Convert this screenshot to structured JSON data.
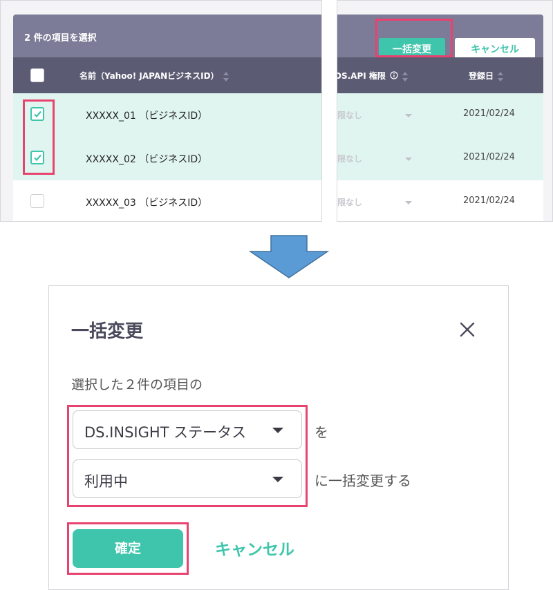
{
  "table_before": {
    "selection_summary": "2 件の項目を選択",
    "columns": {
      "name": "名前（Yahoo! JAPANビジネスID）",
      "api": "DS.API 権限",
      "registered": "登録日"
    },
    "rows": [
      {
        "name": "XXXXX_01 （ビジネスID）",
        "permission": "限なし",
        "date": "2021/02/24",
        "checked": true
      },
      {
        "name": "XXXXX_02 （ビジネスID）",
        "permission": "限なし",
        "date": "2021/02/24",
        "checked": true
      },
      {
        "name": "XXXXX_03 （ビジネスID）",
        "permission": "限なし",
        "date": "2021/02/24",
        "checked": false
      }
    ],
    "bulk_change_label": "一括変更",
    "cancel_label": "キャンセル"
  },
  "modal": {
    "title": "一括変更",
    "intro": "選択した２件の項目の",
    "field_select": "DS.INSIGHT ステータス",
    "field_suffix": "を",
    "value_select": "利用中",
    "value_suffix": "に一括変更する",
    "confirm_label": "確定",
    "cancel_label": "キャンセル"
  },
  "icons": {
    "info": "info-icon",
    "sort": "sort-icon",
    "checkbox_check": "check-icon",
    "close": "close-icon",
    "dropdown": "chevron-down-icon",
    "arrow": "arrow-down-icon"
  },
  "colors": {
    "accent": "#3fc5ab",
    "highlight": "#e8426e",
    "header_dark": "#5b5b73",
    "header_light": "#7c7c98",
    "selected_row": "#e0f5ef",
    "arrow": "#5b9bd5"
  }
}
